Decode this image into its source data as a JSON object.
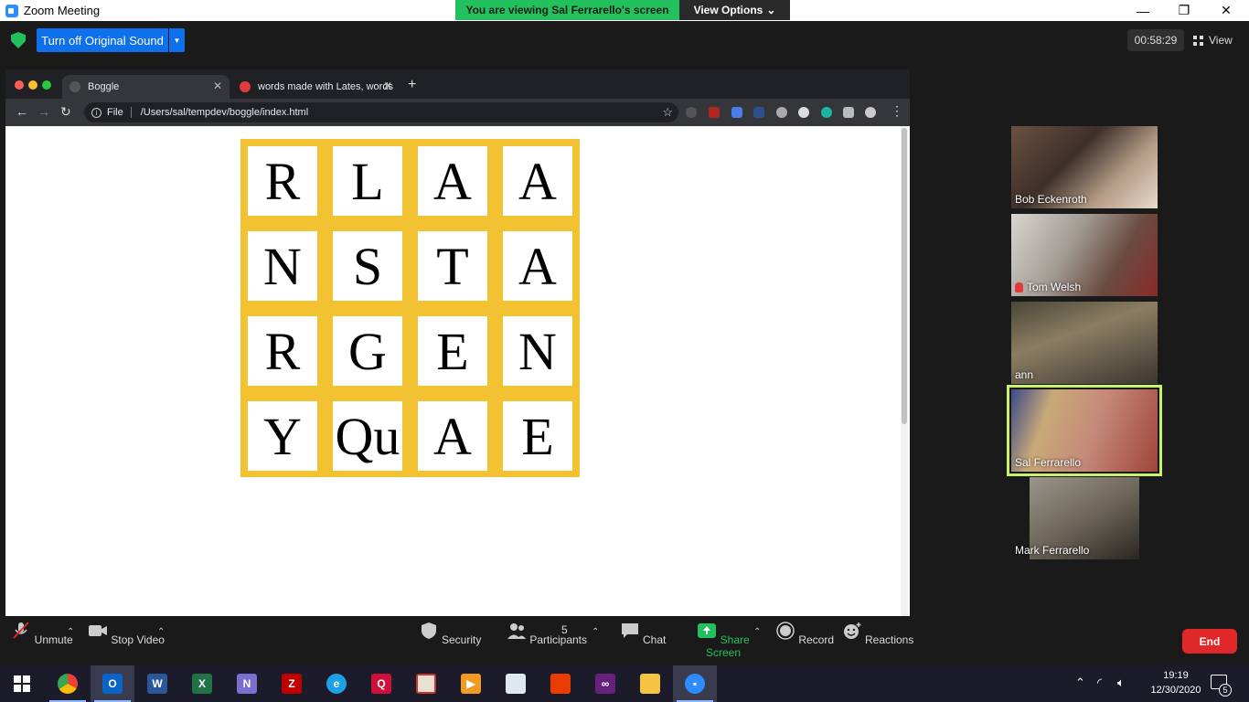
{
  "window": {
    "title": "Zoom Meeting"
  },
  "banner": {
    "viewing": "You are viewing Sal Ferrarello's screen",
    "view_options": "View Options"
  },
  "toolbar": {
    "original_sound": "Turn off Original Sound",
    "timer": "00:58:29",
    "view": "View"
  },
  "browser": {
    "tabs": [
      {
        "title": "Boggle"
      },
      {
        "title": "words made with Lates, words"
      }
    ],
    "address": {
      "scheme": "File",
      "url": "/Users/sal/tempdev/boggle/index.html"
    }
  },
  "board": {
    "rows": [
      [
        "R",
        "L",
        "A",
        "A"
      ],
      [
        "N",
        "S",
        "T",
        "A"
      ],
      [
        "R",
        "G",
        "E",
        "N"
      ],
      [
        "Y",
        "Qu",
        "A",
        "E"
      ]
    ],
    "colors": {
      "frame": "#f3c232",
      "cell": "#ffffff"
    }
  },
  "participants": [
    {
      "name": "Bob Eckenroth",
      "muted": false
    },
    {
      "name": "Tom Welsh",
      "muted": true
    },
    {
      "name": "ann",
      "muted": false
    },
    {
      "name": "Sal Ferrarello",
      "muted": false,
      "active_speaker": true
    },
    {
      "name": "Mark Ferrarello",
      "muted": false
    }
  ],
  "controls": {
    "unmute": "Unmute",
    "stop_video": "Stop Video",
    "security": "Security",
    "participants": "Participants",
    "participants_count": "5",
    "chat": "Chat",
    "share_screen": "Share Screen",
    "record": "Record",
    "reactions": "Reactions",
    "end": "End"
  },
  "taskbar": {
    "apps": [
      "windows-start",
      "chrome",
      "outlook",
      "word",
      "excel",
      "onenote",
      "filezilla",
      "internet-explorer",
      "quicken",
      "paint",
      "video",
      "notepad",
      "office",
      "visual-studio",
      "file-explorer",
      "zoom"
    ],
    "time": "19:19",
    "date": "12/30/2020",
    "notifications": "5"
  }
}
